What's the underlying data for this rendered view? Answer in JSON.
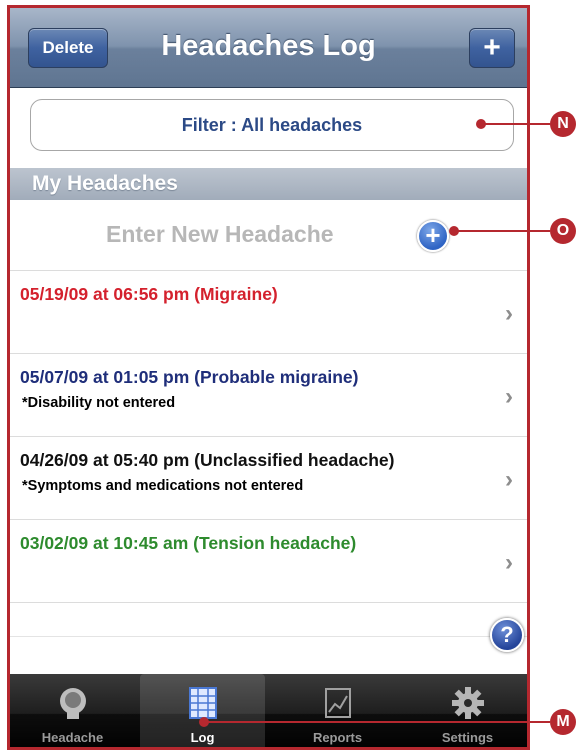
{
  "navbar": {
    "title": "Headaches Log",
    "delete_label": "Delete",
    "add_label": "+"
  },
  "filter": {
    "label": "Filter : All headaches"
  },
  "section": {
    "title": "My Headaches"
  },
  "new_entry": {
    "label": "Enter New Headache"
  },
  "entries": [
    {
      "title": "05/19/09 at 06:56 pm (Migraine)",
      "note": "",
      "color": "#d4212d"
    },
    {
      "title": "05/07/09 at 01:05 pm (Probable migraine)",
      "note": "*Disability not entered",
      "color": "#1f2e7a"
    },
    {
      "title": "04/26/09 at 05:40 pm (Unclassified headache)",
      "note": "*Symptoms and medications not entered",
      "color": "#111111"
    },
    {
      "title": "03/02/09 at 10:45 am (Tension headache)",
      "note": "",
      "color": "#2e8b2e"
    }
  ],
  "tabs": [
    {
      "label": "Headache",
      "icon": "head-icon"
    },
    {
      "label": "Log",
      "icon": "log-icon",
      "active": true
    },
    {
      "label": "Reports",
      "icon": "reports-icon"
    },
    {
      "label": "Settings",
      "icon": "gear-icon"
    }
  ],
  "callouts": {
    "n": "N",
    "o": "O",
    "m": "M"
  },
  "colors": {
    "frame": "#b5282f",
    "accent": "#2f64c4"
  }
}
